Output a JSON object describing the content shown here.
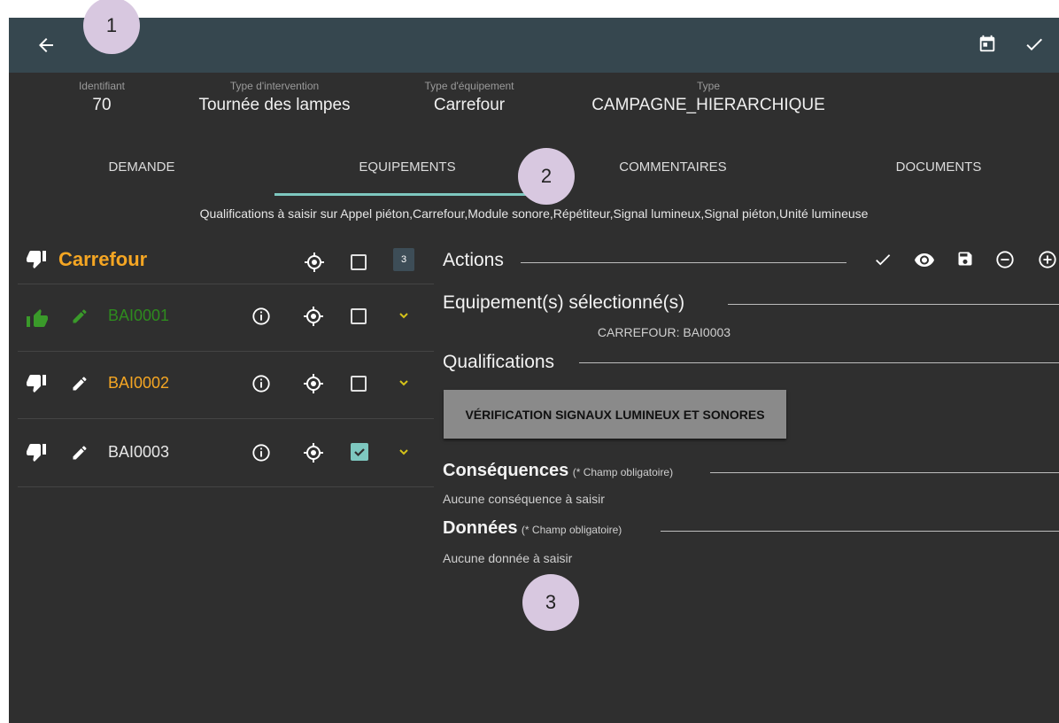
{
  "header": {
    "identifiant": {
      "label": "Identifiant",
      "value": "70"
    },
    "type_intervention": {
      "label": "Type d'intervention",
      "value": "Tournée des lampes"
    },
    "type_equipement": {
      "label": "Type d'équipement",
      "value": "Carrefour"
    },
    "type": {
      "label": "Type",
      "value": "CAMPAGNE_HIERARCHIQUE"
    }
  },
  "tabs": [
    {
      "label": "DEMANDE"
    },
    {
      "label": "EQUIPEMENTS",
      "active": true
    },
    {
      "label": "COMMENTAIRES"
    },
    {
      "label": "DOCUMENTS"
    }
  ],
  "qualifications_notice": "Qualifications à saisir sur Appel piéton,Carrefour,Module sonore,Répétiteur,Signal lumineux,Signal piéton,Unité lumineuse",
  "group": {
    "title": "Carrefour",
    "count": "3"
  },
  "equipments": [
    {
      "code": "BAI0001",
      "status": "up",
      "color": "#2e8b1e",
      "checked": false
    },
    {
      "code": "BAI0002",
      "status": "down",
      "color": "#f5a623",
      "checked": false
    },
    {
      "code": "BAI0003",
      "status": "down",
      "color": "#e8e8e8",
      "checked": true
    }
  ],
  "actions": {
    "title": "Actions"
  },
  "selected": {
    "title": "Equipement(s) sélectionné(s)",
    "value": "CARREFOUR: BAI0003"
  },
  "qualifications": {
    "title": "Qualifications",
    "button": "VÉRIFICATION SIGNAUX LUMINEUX ET SONORES"
  },
  "consequences": {
    "title": "Conséquences",
    "note": "(* Champ obligatoire)",
    "empty": "Aucune conséquence à saisir"
  },
  "donnees": {
    "title": "Données",
    "note": "(* Champ obligatoire)",
    "empty": "Aucune donnée à saisir"
  },
  "callouts": [
    "1",
    "2",
    "3"
  ],
  "colors": {
    "topbar": "#36474f",
    "background": "#2f2f2f",
    "accent_tab": "#7ec8c0",
    "orange": "#f5a623",
    "green": "#2e8b1e",
    "checkbox_checked": "#7ec8c0"
  }
}
